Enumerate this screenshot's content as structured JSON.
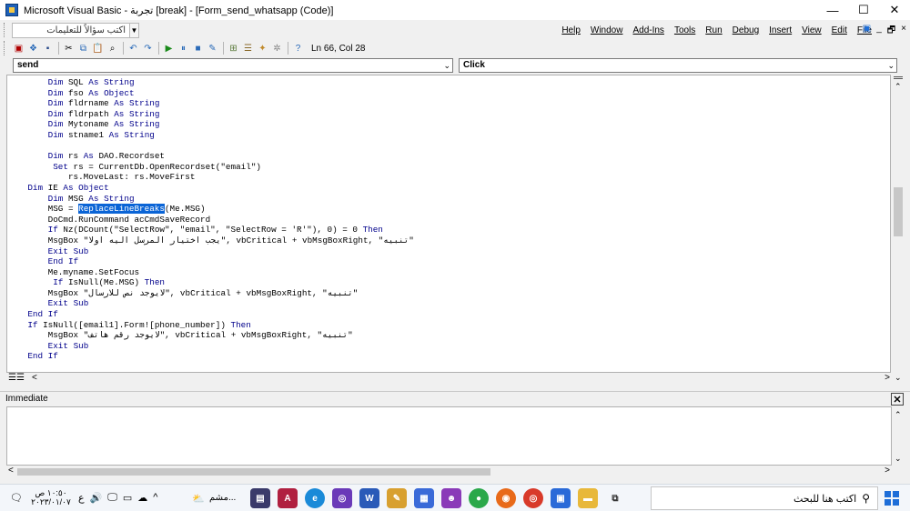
{
  "window": {
    "title": "Microsoft Visual Basic - تجربة [break] - [Form_send_whatsapp (Code)]",
    "controls": [
      "—",
      "☐",
      "✕"
    ]
  },
  "helpbox": {
    "text": "اكتب سؤالاً للتعليمات"
  },
  "menus": [
    "Help",
    "Window",
    "Add-Ins",
    "Tools",
    "Run",
    "Debug",
    "Insert",
    "View",
    "Edit",
    "File"
  ],
  "menu_right": [
    "🗗",
    "_",
    "🗗",
    "×"
  ],
  "toolbar": {
    "position": "Ln 66, Col 28"
  },
  "combos": {
    "object": "send",
    "procedure": "Click"
  },
  "code": [
    "        Dim SQL As String",
    "        Dim fso As Object",
    "        Dim fldrname As String",
    "        Dim fldrpath As String",
    "        Dim Mytoname As String",
    "        Dim stname1 As String",
    "",
    "        Dim rs As DAO.Recordset",
    "         Set rs = CurrentDb.OpenRecordset(\"email\")",
    "            rs.MoveLast: rs.MoveFirst",
    "    Dim IE As Object",
    "        Dim MSG As String",
    "        MSG = ReplaceLineBreaks(Me.MSG)",
    "        DoCmd.RunCommand acCmdSaveRecord",
    "        If Nz(DCount(\"SelectRow\", \"email\", \"SelectRow = 'R'\"), 0) = 0 Then",
    "        MsgBox \"يجب اختيار المرسل اليه اولا\", vbCritical + vbMsgBoxRight, \"تنبيه\"",
    "        Exit Sub",
    "        End If",
    "        Me.myname.SetFocus",
    "         If IsNull(Me.MSG) Then",
    "        MsgBox \"لايوجد نص للارسال\", vbCritical + vbMsgBoxRight, \"تنبيه\"",
    "        Exit Sub",
    "    End If",
    "    If IsNull([email1].Form![phone_number]) Then",
    "        MsgBox \"لايوجد رقم هاتف\", vbCritical + vbMsgBoxRight, \"تنبيه\"",
    "        Exit Sub",
    "    End If"
  ],
  "selection": "ReplaceLineBreaks",
  "immediate": {
    "title": "Immediate",
    "close": "✕"
  },
  "taskbar": {
    "time": "١٠:٥٠ ص",
    "date": "٢٠٢٣/٠١/٠٧",
    "lang": "ع",
    "pinned_label": "مشم...",
    "search_placeholder": "اكتب هنا للبحث"
  },
  "colors": {
    "keyword": "#00008b",
    "selection": "#0a64d6",
    "start": "#1e6ed8"
  }
}
